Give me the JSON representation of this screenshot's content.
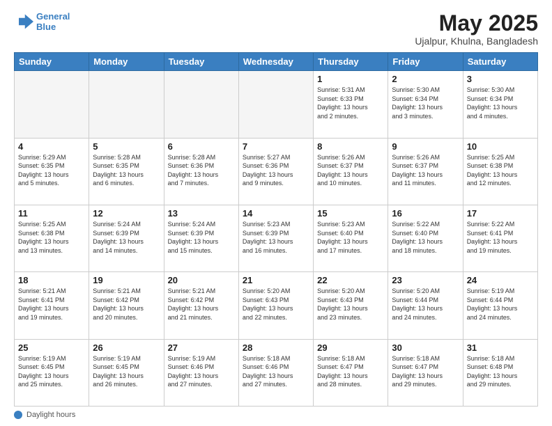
{
  "header": {
    "logo_line1": "General",
    "logo_line2": "Blue",
    "main_title": "May 2025",
    "subtitle": "Ujalpur, Khulna, Bangladesh"
  },
  "days_of_week": [
    "Sunday",
    "Monday",
    "Tuesday",
    "Wednesday",
    "Thursday",
    "Friday",
    "Saturday"
  ],
  "footer": {
    "label": "Daylight hours"
  },
  "weeks": [
    [
      {
        "num": "",
        "info": ""
      },
      {
        "num": "",
        "info": ""
      },
      {
        "num": "",
        "info": ""
      },
      {
        "num": "",
        "info": ""
      },
      {
        "num": "1",
        "info": "Sunrise: 5:31 AM\nSunset: 6:33 PM\nDaylight: 13 hours\nand 2 minutes."
      },
      {
        "num": "2",
        "info": "Sunrise: 5:30 AM\nSunset: 6:34 PM\nDaylight: 13 hours\nand 3 minutes."
      },
      {
        "num": "3",
        "info": "Sunrise: 5:30 AM\nSunset: 6:34 PM\nDaylight: 13 hours\nand 4 minutes."
      }
    ],
    [
      {
        "num": "4",
        "info": "Sunrise: 5:29 AM\nSunset: 6:35 PM\nDaylight: 13 hours\nand 5 minutes."
      },
      {
        "num": "5",
        "info": "Sunrise: 5:28 AM\nSunset: 6:35 PM\nDaylight: 13 hours\nand 6 minutes."
      },
      {
        "num": "6",
        "info": "Sunrise: 5:28 AM\nSunset: 6:36 PM\nDaylight: 13 hours\nand 7 minutes."
      },
      {
        "num": "7",
        "info": "Sunrise: 5:27 AM\nSunset: 6:36 PM\nDaylight: 13 hours\nand 9 minutes."
      },
      {
        "num": "8",
        "info": "Sunrise: 5:26 AM\nSunset: 6:37 PM\nDaylight: 13 hours\nand 10 minutes."
      },
      {
        "num": "9",
        "info": "Sunrise: 5:26 AM\nSunset: 6:37 PM\nDaylight: 13 hours\nand 11 minutes."
      },
      {
        "num": "10",
        "info": "Sunrise: 5:25 AM\nSunset: 6:38 PM\nDaylight: 13 hours\nand 12 minutes."
      }
    ],
    [
      {
        "num": "11",
        "info": "Sunrise: 5:25 AM\nSunset: 6:38 PM\nDaylight: 13 hours\nand 13 minutes."
      },
      {
        "num": "12",
        "info": "Sunrise: 5:24 AM\nSunset: 6:39 PM\nDaylight: 13 hours\nand 14 minutes."
      },
      {
        "num": "13",
        "info": "Sunrise: 5:24 AM\nSunset: 6:39 PM\nDaylight: 13 hours\nand 15 minutes."
      },
      {
        "num": "14",
        "info": "Sunrise: 5:23 AM\nSunset: 6:39 PM\nDaylight: 13 hours\nand 16 minutes."
      },
      {
        "num": "15",
        "info": "Sunrise: 5:23 AM\nSunset: 6:40 PM\nDaylight: 13 hours\nand 17 minutes."
      },
      {
        "num": "16",
        "info": "Sunrise: 5:22 AM\nSunset: 6:40 PM\nDaylight: 13 hours\nand 18 minutes."
      },
      {
        "num": "17",
        "info": "Sunrise: 5:22 AM\nSunset: 6:41 PM\nDaylight: 13 hours\nand 19 minutes."
      }
    ],
    [
      {
        "num": "18",
        "info": "Sunrise: 5:21 AM\nSunset: 6:41 PM\nDaylight: 13 hours\nand 19 minutes."
      },
      {
        "num": "19",
        "info": "Sunrise: 5:21 AM\nSunset: 6:42 PM\nDaylight: 13 hours\nand 20 minutes."
      },
      {
        "num": "20",
        "info": "Sunrise: 5:21 AM\nSunset: 6:42 PM\nDaylight: 13 hours\nand 21 minutes."
      },
      {
        "num": "21",
        "info": "Sunrise: 5:20 AM\nSunset: 6:43 PM\nDaylight: 13 hours\nand 22 minutes."
      },
      {
        "num": "22",
        "info": "Sunrise: 5:20 AM\nSunset: 6:43 PM\nDaylight: 13 hours\nand 23 minutes."
      },
      {
        "num": "23",
        "info": "Sunrise: 5:20 AM\nSunset: 6:44 PM\nDaylight: 13 hours\nand 24 minutes."
      },
      {
        "num": "24",
        "info": "Sunrise: 5:19 AM\nSunset: 6:44 PM\nDaylight: 13 hours\nand 24 minutes."
      }
    ],
    [
      {
        "num": "25",
        "info": "Sunrise: 5:19 AM\nSunset: 6:45 PM\nDaylight: 13 hours\nand 25 minutes."
      },
      {
        "num": "26",
        "info": "Sunrise: 5:19 AM\nSunset: 6:45 PM\nDaylight: 13 hours\nand 26 minutes."
      },
      {
        "num": "27",
        "info": "Sunrise: 5:19 AM\nSunset: 6:46 PM\nDaylight: 13 hours\nand 27 minutes."
      },
      {
        "num": "28",
        "info": "Sunrise: 5:18 AM\nSunset: 6:46 PM\nDaylight: 13 hours\nand 27 minutes."
      },
      {
        "num": "29",
        "info": "Sunrise: 5:18 AM\nSunset: 6:47 PM\nDaylight: 13 hours\nand 28 minutes."
      },
      {
        "num": "30",
        "info": "Sunrise: 5:18 AM\nSunset: 6:47 PM\nDaylight: 13 hours\nand 29 minutes."
      },
      {
        "num": "31",
        "info": "Sunrise: 5:18 AM\nSunset: 6:48 PM\nDaylight: 13 hours\nand 29 minutes."
      }
    ]
  ]
}
